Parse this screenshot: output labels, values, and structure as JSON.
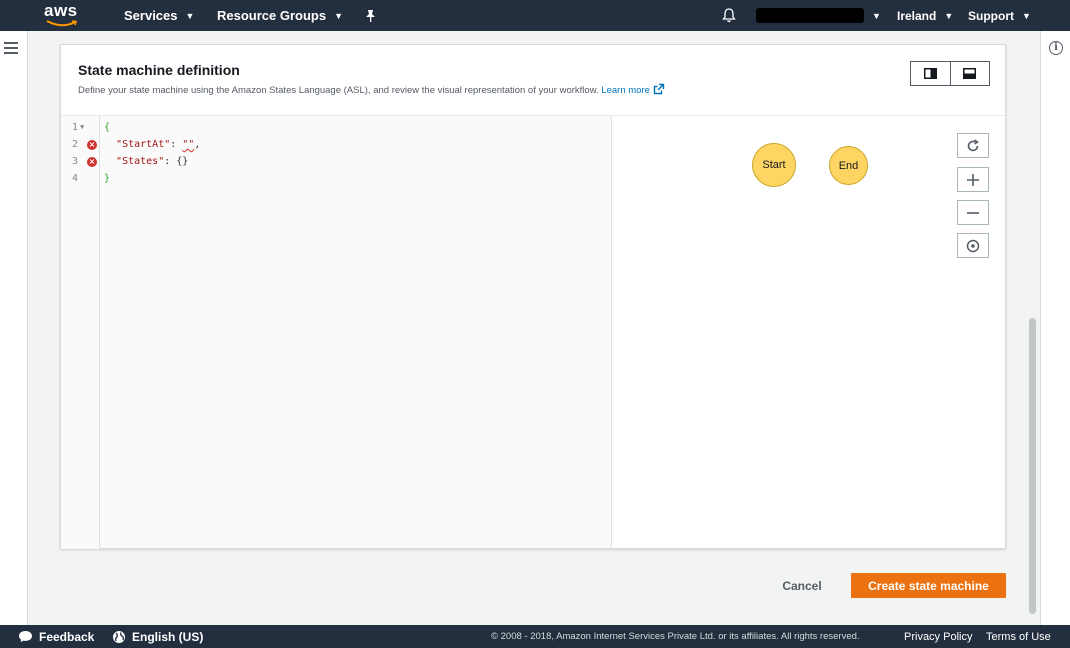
{
  "nav": {
    "logo_text": "aws",
    "services": "Services",
    "resource_groups": "Resource Groups",
    "pin_icon": "pin-icon",
    "bell_icon": "bell-icon",
    "region": "Ireland",
    "support": "Support",
    "colors": {
      "bg": "#232f3e",
      "logo_smile": "#ff9900"
    }
  },
  "panel": {
    "title": "State machine definition",
    "description": "Define your state machine using the Amazon States Language (ASL), and review the visual representation of your workflow.",
    "learn_more": "Learn more"
  },
  "editor": {
    "lines": [
      {
        "num": "1",
        "fold": true,
        "error": false
      },
      {
        "num": "2",
        "fold": false,
        "error": true
      },
      {
        "num": "3",
        "fold": false,
        "error": true
      },
      {
        "num": "4",
        "fold": false,
        "error": false
      }
    ],
    "code": {
      "open_brace": "{",
      "key_startat": "\"StartAt\"",
      "colon": ": ",
      "value_startat": "\"\"",
      "comma": ",",
      "key_states": "\"States\"",
      "value_states": "{}",
      "close_brace": "}"
    }
  },
  "graph": {
    "start_label": "Start",
    "end_label": "End",
    "node_color": "#fed563",
    "controls": [
      "refresh-icon",
      "zoom-in-icon",
      "zoom-out-icon",
      "center-icon"
    ]
  },
  "actions": {
    "cancel": "Cancel",
    "create": "Create state machine",
    "create_color": "#ec7211"
  },
  "footer": {
    "feedback": "Feedback",
    "language": "English (US)",
    "copyright": "© 2008 - 2018, Amazon Internet Services Private Ltd. or its affiliates. All rights reserved.",
    "privacy": "Privacy Policy",
    "terms": "Terms of Use"
  }
}
